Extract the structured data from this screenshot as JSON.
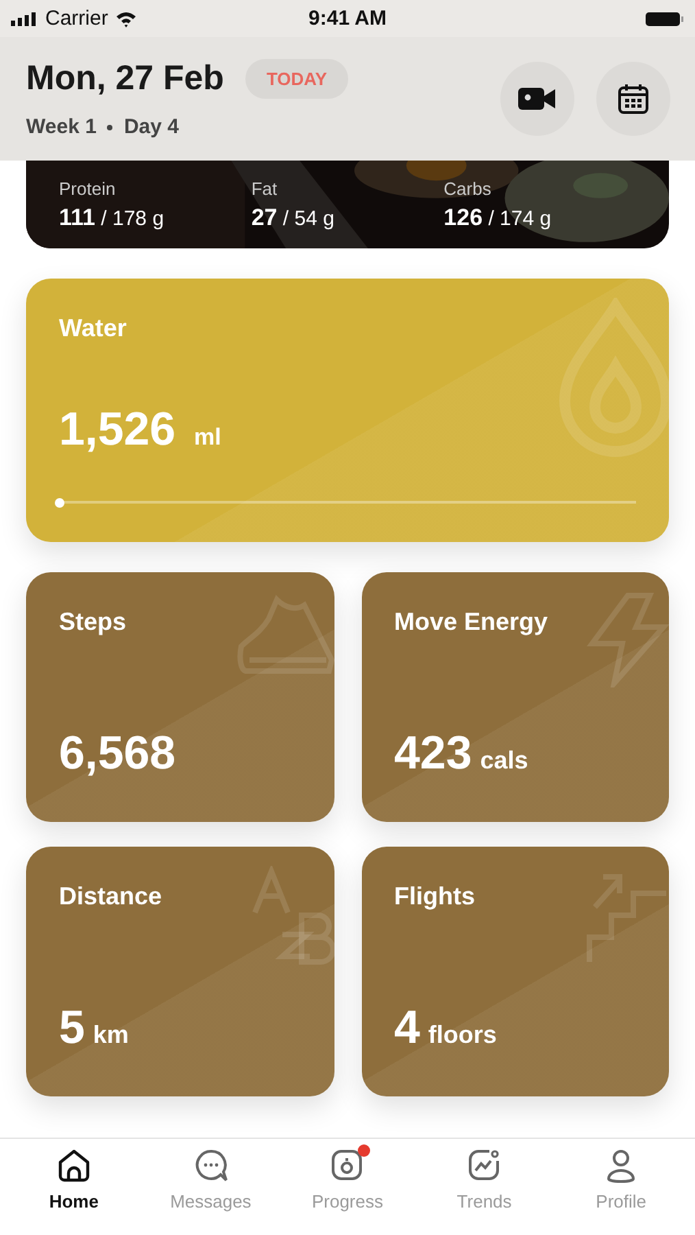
{
  "status_bar": {
    "carrier": "Carrier",
    "time": "9:41 AM"
  },
  "header": {
    "date": "Mon, 27 Feb",
    "badge": "TODAY",
    "week": "Week 1",
    "day": "Day 4"
  },
  "macros": [
    {
      "label": "Protein",
      "value": "111",
      "target": "/ 178 g"
    },
    {
      "label": "Fat",
      "value": "27",
      "target": "/ 54 g"
    },
    {
      "label": "Carbs",
      "value": "126",
      "target": "/ 174 g"
    }
  ],
  "water": {
    "title": "Water",
    "value": "1,526",
    "unit": "ml",
    "level": 0
  },
  "stats": [
    {
      "kind": "steps",
      "title": "Steps",
      "value": "6,568"
    },
    {
      "kind": "energy",
      "title": "Move Energy",
      "value": "423",
      "unit": "cals"
    },
    {
      "kind": "distance",
      "title": "Distance",
      "value": "5",
      "unit": "km"
    },
    {
      "kind": "flights",
      "title": "Flights",
      "value": "4",
      "unit": "floors"
    }
  ],
  "tabs": [
    {
      "kind": "home",
      "label": "Home",
      "selected": true,
      "badge": false
    },
    {
      "kind": "messages",
      "label": "Messages",
      "selected": false,
      "badge": false
    },
    {
      "kind": "progress",
      "label": "Progress",
      "selected": false,
      "badge": true
    },
    {
      "kind": "trends",
      "label": "Trends",
      "selected": false,
      "badge": false
    },
    {
      "kind": "profile",
      "label": "Profile",
      "selected": false,
      "badge": false
    }
  ]
}
